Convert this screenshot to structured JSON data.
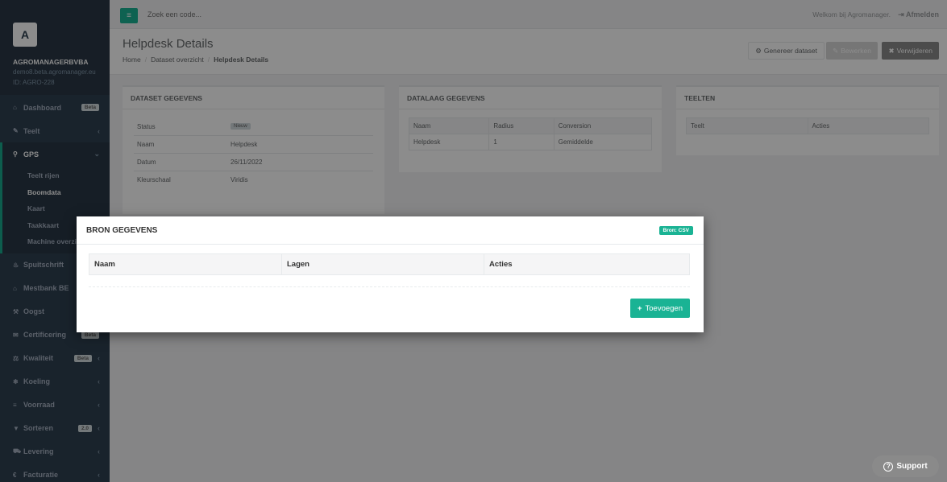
{
  "sidebar": {
    "avatar": "A",
    "company": "AGROMANAGERBVBA",
    "email": "demo8.beta.agromanager.eu",
    "id": "ID: AGRO-228",
    "items": [
      {
        "icon": "⌂",
        "label": "Dashboard",
        "badge": "Beta"
      },
      {
        "icon": "✎",
        "label": "Teelt",
        "chev": "‹"
      },
      {
        "icon": "⚲",
        "label": "GPS",
        "chev": "⌄"
      },
      {
        "icon": "♨",
        "label": "Spuitschrift"
      },
      {
        "icon": "⌂",
        "label": "Mestbank BE"
      },
      {
        "icon": "⚒",
        "label": "Oogst"
      },
      {
        "icon": "✉",
        "label": "Certificering",
        "badge": "Beta"
      },
      {
        "icon": "⚖",
        "label": "Kwaliteit",
        "badge": "Beta",
        "chev": "‹"
      },
      {
        "icon": "❄",
        "label": "Koeling",
        "chev": "‹"
      },
      {
        "icon": "≡",
        "label": "Voorraad",
        "chev": "‹"
      },
      {
        "icon": "▼",
        "label": "Sorteren",
        "badge": "2.0",
        "chev": "‹"
      },
      {
        "icon": "⛟",
        "label": "Levering",
        "chev": "‹"
      },
      {
        "icon": "€",
        "label": "Facturatie",
        "chev": "‹"
      }
    ],
    "gps_sub": [
      "Teelt rijen",
      "Boomdata",
      "Kaart",
      "Taakkaart",
      "Machine overzicht"
    ]
  },
  "topbar": {
    "menu_icon": "≡",
    "search_placeholder": "Zoek een code...",
    "welcome": "Welkom bij Agromanager.",
    "logout": "Afmelden",
    "logout_icon": "⇥"
  },
  "heading": {
    "title": "Helpdesk Details",
    "breadcrumb": [
      "Home",
      "Dataset overzicht",
      "Helpdesk Details"
    ],
    "btn_generate": "Genereer dataset",
    "btn_edit": "Bewerken",
    "btn_delete": "Verwijderen"
  },
  "dataset": {
    "title": "DATASET GEGEVENS",
    "rows": [
      {
        "k": "Status",
        "v": "Nieuw"
      },
      {
        "k": "Naam",
        "v": "Helpdesk"
      },
      {
        "k": "Datum",
        "v": "26/11/2022"
      },
      {
        "k": "Kleurschaal",
        "v": "Viridis"
      }
    ]
  },
  "datalaag": {
    "title": "DATALAAG GEGEVENS",
    "headers": [
      "Naam",
      "Radius",
      "Conversion"
    ],
    "row": [
      "Helpdesk",
      "1",
      "Gemiddelde"
    ]
  },
  "teelten": {
    "title": "TEELTEN",
    "headers": [
      "Teelt",
      "Acties"
    ]
  },
  "modal": {
    "title": "BRON GEGEVENS",
    "badge": "Bron: CSV",
    "headers": [
      "Naam",
      "Lagen",
      "Acties"
    ],
    "add_label": "Toevoegen"
  },
  "support": {
    "label": "Support",
    "icon": "?"
  },
  "colors": {
    "accent": "#1ab394",
    "sidebar": "#2f4050"
  }
}
